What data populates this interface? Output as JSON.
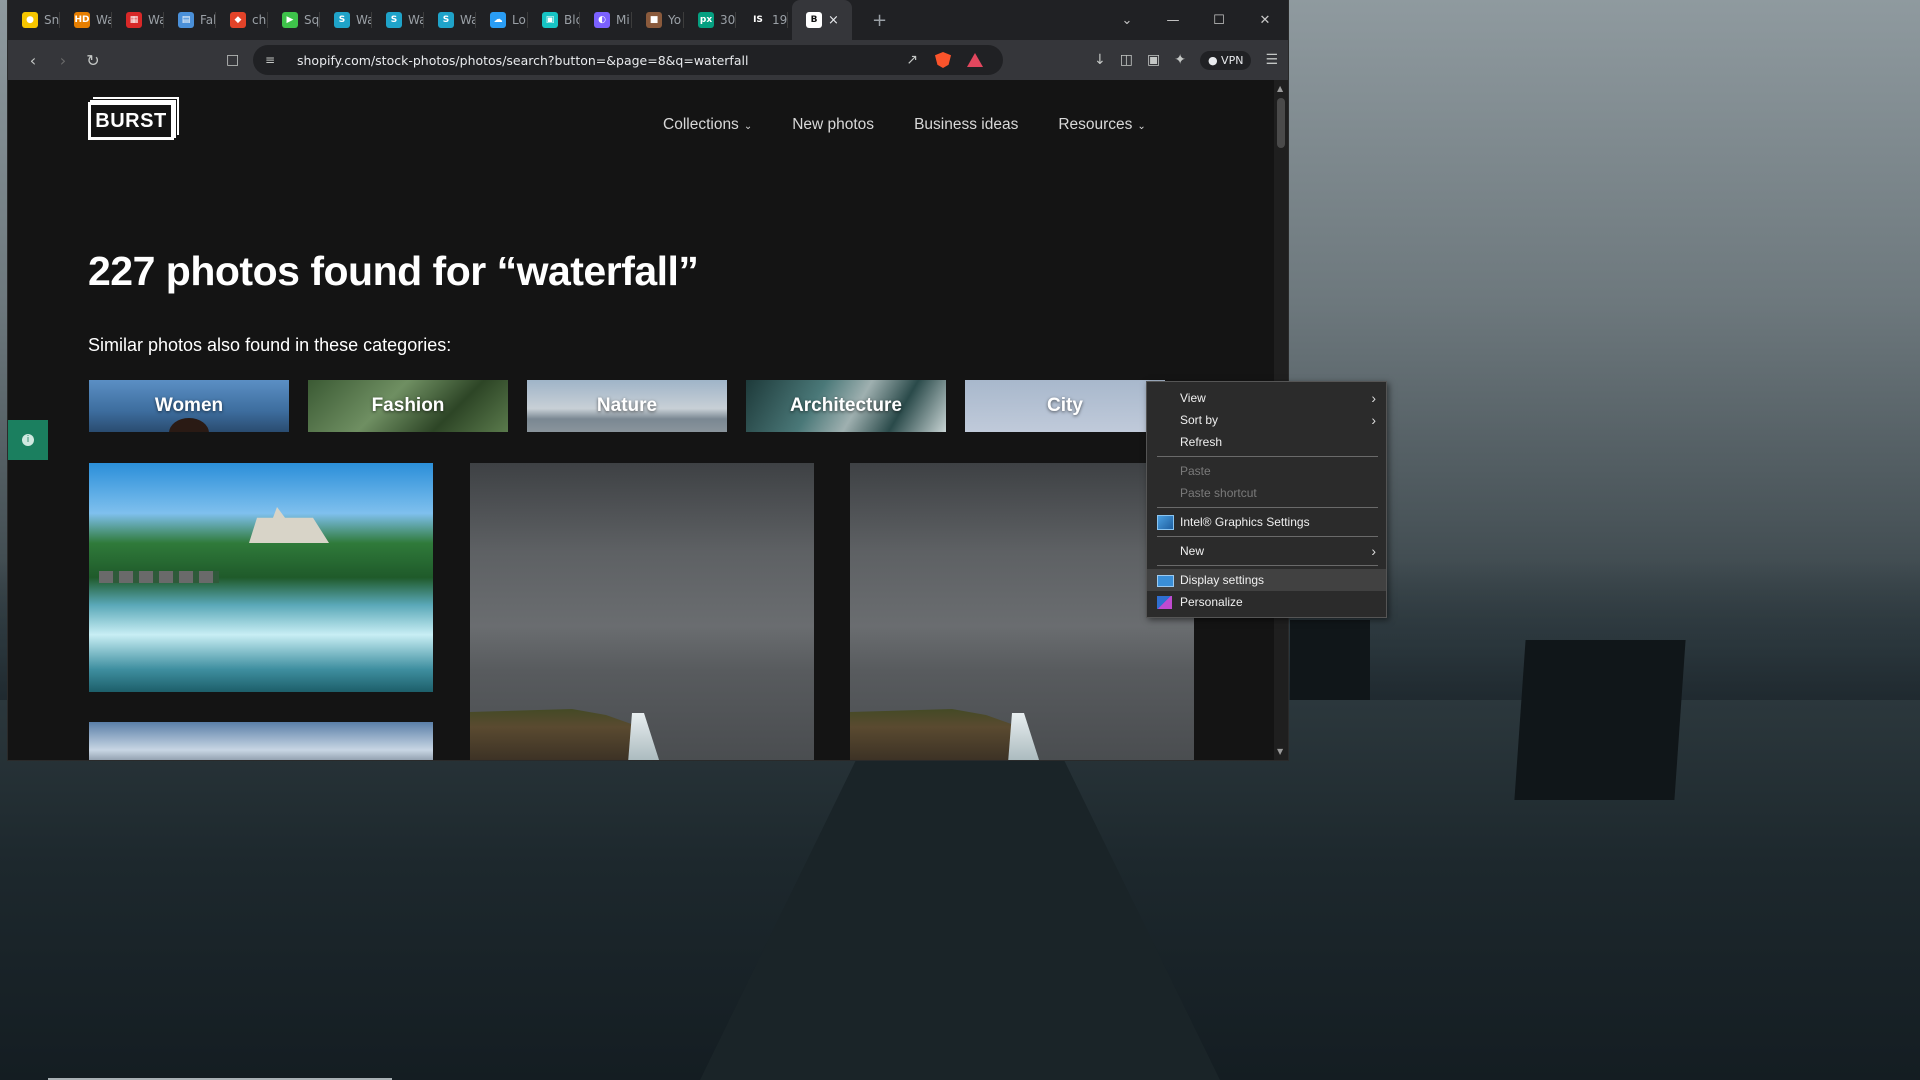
{
  "tabs": [
    {
      "title": "Sn",
      "color": "#f7c600",
      "glyph": "●"
    },
    {
      "title": "Wa",
      "color": "#e67e00",
      "glyph": "HD"
    },
    {
      "title": "Wa",
      "color": "#d82828",
      "glyph": "▦"
    },
    {
      "title": "Fak",
      "color": "#4a90d9",
      "glyph": "▤"
    },
    {
      "title": "che",
      "color": "#e24329",
      "glyph": "◆"
    },
    {
      "title": "Sq",
      "color": "#3ec24a",
      "glyph": "▶"
    },
    {
      "title": "Wa",
      "color": "#1fa3c9",
      "glyph": "S"
    },
    {
      "title": "Wa",
      "color": "#1fa3c9",
      "glyph": "S"
    },
    {
      "title": "Wa",
      "color": "#1fa3c9",
      "glyph": "S"
    },
    {
      "title": "Lo",
      "color": "#2a9df4",
      "glyph": "☁"
    },
    {
      "title": "Blo",
      "color": "#16c4c4",
      "glyph": "▣"
    },
    {
      "title": "Mi",
      "color": "#7b61ff",
      "glyph": "◐"
    },
    {
      "title": "Yo",
      "color": "#8a5a3c",
      "glyph": "■"
    },
    {
      "title": "30",
      "color": "#05a081",
      "glyph": "px"
    },
    {
      "title": "19",
      "color": "#202124",
      "glyph": "IS"
    }
  ],
  "active_tab": {
    "glyph": "B",
    "close": "×"
  },
  "url": "shopify.com/stock-photos/photos/search?button=&page=8&q=waterfall",
  "vpn_label": "VPN",
  "site": {
    "logo": "BURST",
    "nav": [
      "Collections",
      "New photos",
      "Business ideas",
      "Resources"
    ],
    "heading": "227 photos found for “waterfall”",
    "subheading": "Similar photos also found in these categories:",
    "categories": [
      "Women",
      "Fashion",
      "Nature",
      "Architecture",
      "City"
    ]
  },
  "context_menu": {
    "view": "View",
    "sort_by": "Sort by",
    "refresh": "Refresh",
    "paste": "Paste",
    "paste_shortcut": "Paste shortcut",
    "intel": "Intel® Graphics Settings",
    "new": "New",
    "display_settings": "Display settings",
    "personalize": "Personalize"
  },
  "colors": {
    "accent_green": "#1b7f5f",
    "menu_bg": "#2b2b2b",
    "page_bg": "#141414"
  }
}
